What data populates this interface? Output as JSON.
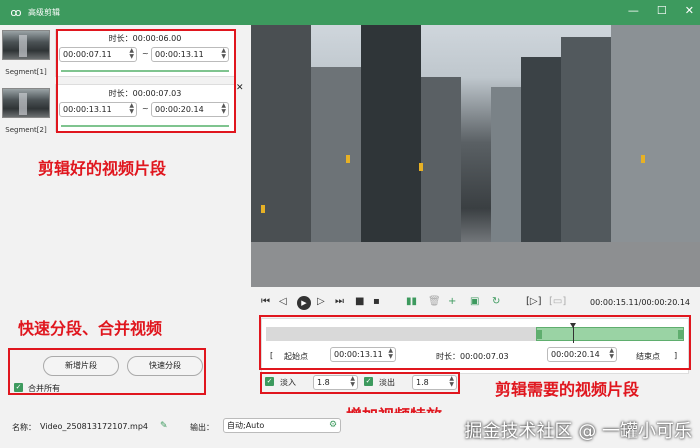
{
  "window": {
    "title": "高级剪辑",
    "minimize": "—",
    "maximize": "☐",
    "close": "✕"
  },
  "segments": [
    {
      "label": "Segment[1]",
      "duration": "时长：00:00:06.00",
      "start": "00:00:07.11",
      "end": "00:00:13.11"
    },
    {
      "label": "Segment[2]",
      "duration": "时长：00:00:07.03",
      "start": "00:00:13.11",
      "end": "00:00:20.14"
    }
  ],
  "segment_close": "✕",
  "annotations": {
    "clips": "剪辑好的视频片段",
    "split_merge": "快速分段、合并视频",
    "need_clip": "剪辑需要的视频片段",
    "add_fade": "增加视频特效"
  },
  "buttons": {
    "new_segment": "新增片段",
    "quick_split": "快速分段",
    "merge_all": "合并所有"
  },
  "player": {
    "timecode": "00:00:15.11/00:00:20.14"
  },
  "timeline": {
    "start_label": "起始点",
    "start_value": "00:00:13.11",
    "duration_label": "时长：00:00:07.03",
    "end_value": "00:00:20.14",
    "end_label": "结束点"
  },
  "effects": {
    "fade_in_label": "淡入",
    "fade_in_value": "1.8",
    "fade_out_label": "淡出",
    "fade_out_value": "1.8"
  },
  "bottom": {
    "name_label": "名称：",
    "name_value": "Video_250813172107.mp4",
    "output_label": "输出：",
    "output_value": "自动;Auto"
  },
  "watermark": "掘金技术社区 @ 一罐小可乐",
  "colors": {
    "accent": "#3d9a5e",
    "annotation": "#e0161e"
  }
}
